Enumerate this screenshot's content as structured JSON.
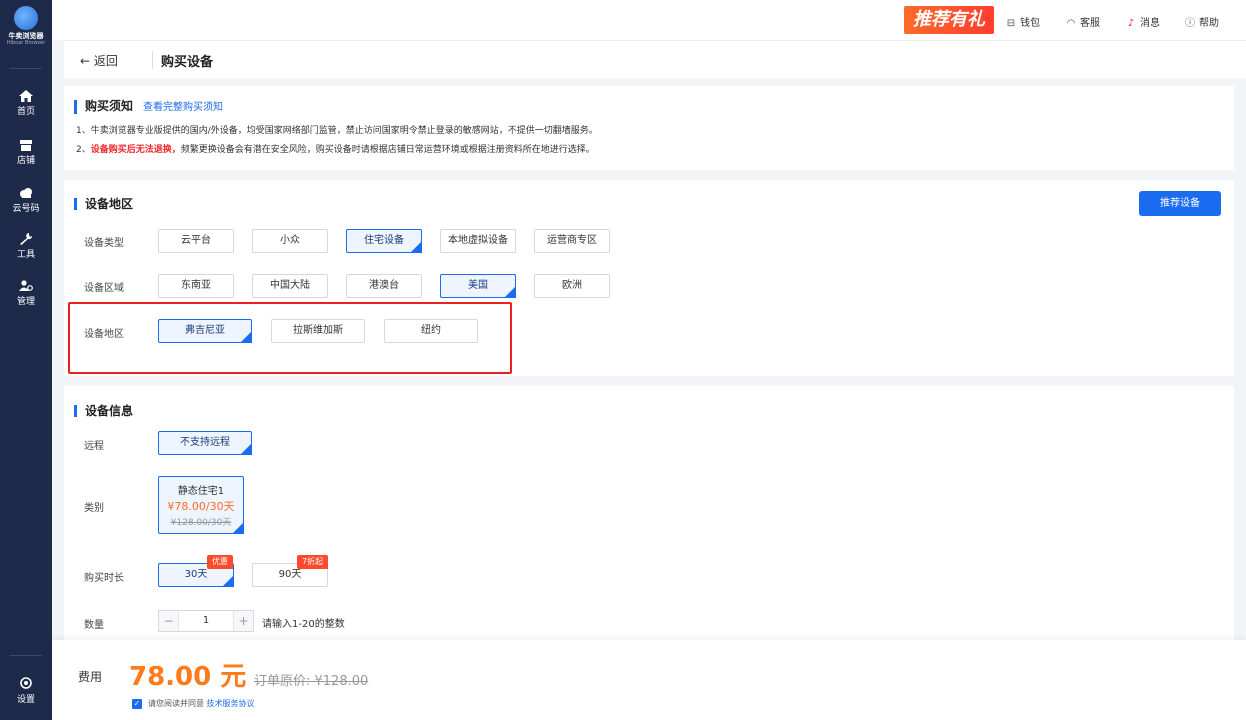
{
  "sidebar": {
    "brand": "牛卖浏览器",
    "brand_sub": "Hiboar Browser",
    "items": [
      {
        "label": "首页",
        "icon": "home-icon"
      },
      {
        "label": "店铺",
        "icon": "store-icon"
      },
      {
        "label": "云号码",
        "icon": "cloud-icon"
      },
      {
        "label": "工具",
        "icon": "wrench-icon"
      },
      {
        "label": "管理",
        "icon": "users-icon"
      }
    ],
    "settings_label": "设置"
  },
  "topbar": {
    "promo": "推荐有礼",
    "wallet": "钱包",
    "service": "客服",
    "messages": "消息",
    "help": "帮助"
  },
  "breadcrumb": {
    "back": "返回",
    "title": "购买设备"
  },
  "notice": {
    "title": "购买须知",
    "link": "查看完整购买须知",
    "line1": "1、牛卖浏览器专业版提供的国内/外设备，均受国家网络部门监管，禁止访问国家明令禁止登录的敏感网站，不提供一切翻墙服务。",
    "line2_prefix": "2、",
    "line2_red": "设备购买后无法退换，",
    "line2_rest": "频繁更换设备会有潜在安全风险，购买设备时请根据店铺日常运营环境或根据注册资料所在地进行选择。"
  },
  "region_section": {
    "title": "设备地区",
    "recommend_button": "推荐设备",
    "type_label": "设备类型",
    "types": [
      "云平台",
      "小众",
      "住宅设备",
      "本地虚拟设备",
      "运营商专区"
    ],
    "type_selected": "住宅设备",
    "area_label": "设备区域",
    "areas": [
      "东南亚",
      "中国大陆",
      "港澳台",
      "美国",
      "欧洲"
    ],
    "area_selected": "美国",
    "region_label": "设备地区",
    "regions": [
      "弗吉尼亚",
      "拉斯维加斯",
      "纽约"
    ],
    "region_selected": "弗吉尼亚"
  },
  "info_section": {
    "title": "设备信息",
    "remote_label": "远程",
    "remote_value": "不支持远程",
    "category_label": "类别",
    "category_name": "静态住宅1",
    "category_price": "¥78.00/30天",
    "category_orig": "¥128.00/30天",
    "duration_label": "购买时长",
    "durations": [
      {
        "label": "30天",
        "badge": "优惠"
      },
      {
        "label": "90天",
        "badge": "7折起"
      }
    ],
    "quantity_label": "数量",
    "quantity_value": "1",
    "quantity_minus": "−",
    "quantity_plus": "+",
    "quantity_hint": "请输入1-20的整数"
  },
  "footer": {
    "fee_label": "费用",
    "fee_value": "78.00 元",
    "orig_price": "订单原价: ¥128.00",
    "agree_text": "请您阅读并同意",
    "agree_link": "技术服务协议"
  },
  "colors": {
    "primary": "#1a6cf0",
    "accent": "#ff7a1a",
    "alert": "#e8211f",
    "sidebar": "#1e2a4a"
  }
}
